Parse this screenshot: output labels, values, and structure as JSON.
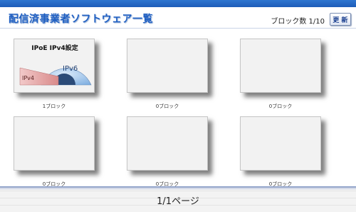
{
  "header": {
    "title": "配信済事業者ソフトウェア一覧",
    "block_count": "ブロック数 1/10",
    "refresh_label": "更 新"
  },
  "tiles": [
    {
      "title": "IPoE IPv4設定",
      "label_ipv4": "IPv4",
      "label_ipv6": "IPv6",
      "caption": "1ブロック"
    },
    {
      "caption": "0ブロック"
    },
    {
      "caption": "0ブロック"
    },
    {
      "caption": "0ブロック"
    },
    {
      "caption": "0ブロック"
    },
    {
      "caption": "0ブロック"
    }
  ],
  "footer": {
    "page_indicator": "1/1ページ"
  },
  "colors": {
    "accent": "#1f5fc2",
    "ipv6_fill": "#8fb8e6",
    "ipv4_fill": "#e3a4a4"
  }
}
